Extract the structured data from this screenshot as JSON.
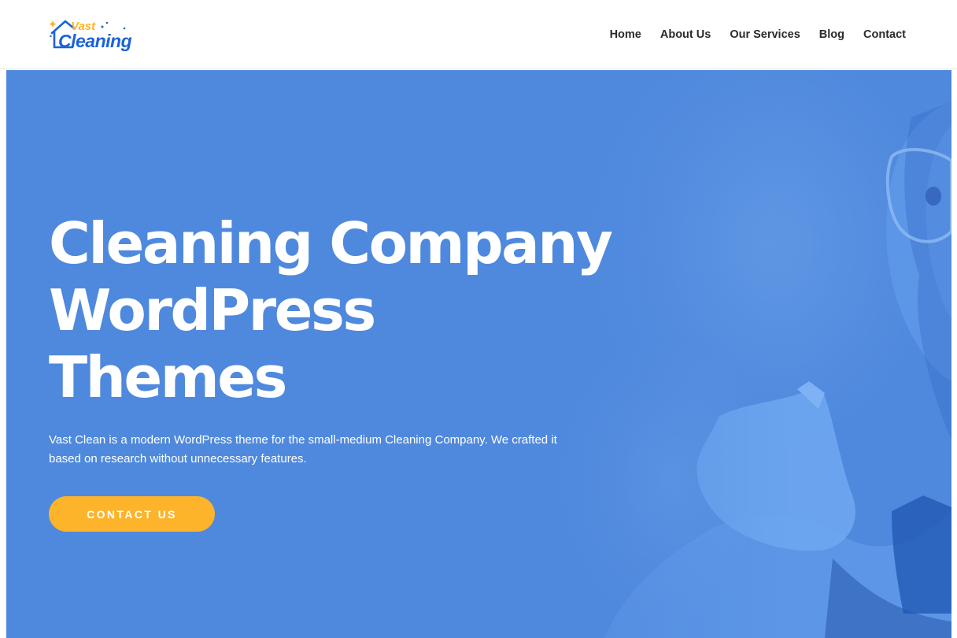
{
  "brand": {
    "logo_top": "Vast",
    "logo_bottom": "Cleaning",
    "primary_color": "#1a63d6",
    "accent_color": "#fdb42b"
  },
  "nav": {
    "items": [
      {
        "label": "Home"
      },
      {
        "label": "About Us"
      },
      {
        "label": "Our Services"
      },
      {
        "label": "Blog"
      },
      {
        "label": "Contact"
      }
    ]
  },
  "hero": {
    "title_line_1": "Cleaning Company",
    "title_line_2": "WordPress",
    "title_line_3": "Themes",
    "description": "Vast Clean is a modern WordPress theme for the small-medium Cleaning Company. We crafted it based on research without unnecessary features.",
    "cta_label": "CONTACT US",
    "background_color": "#4f89dd"
  }
}
